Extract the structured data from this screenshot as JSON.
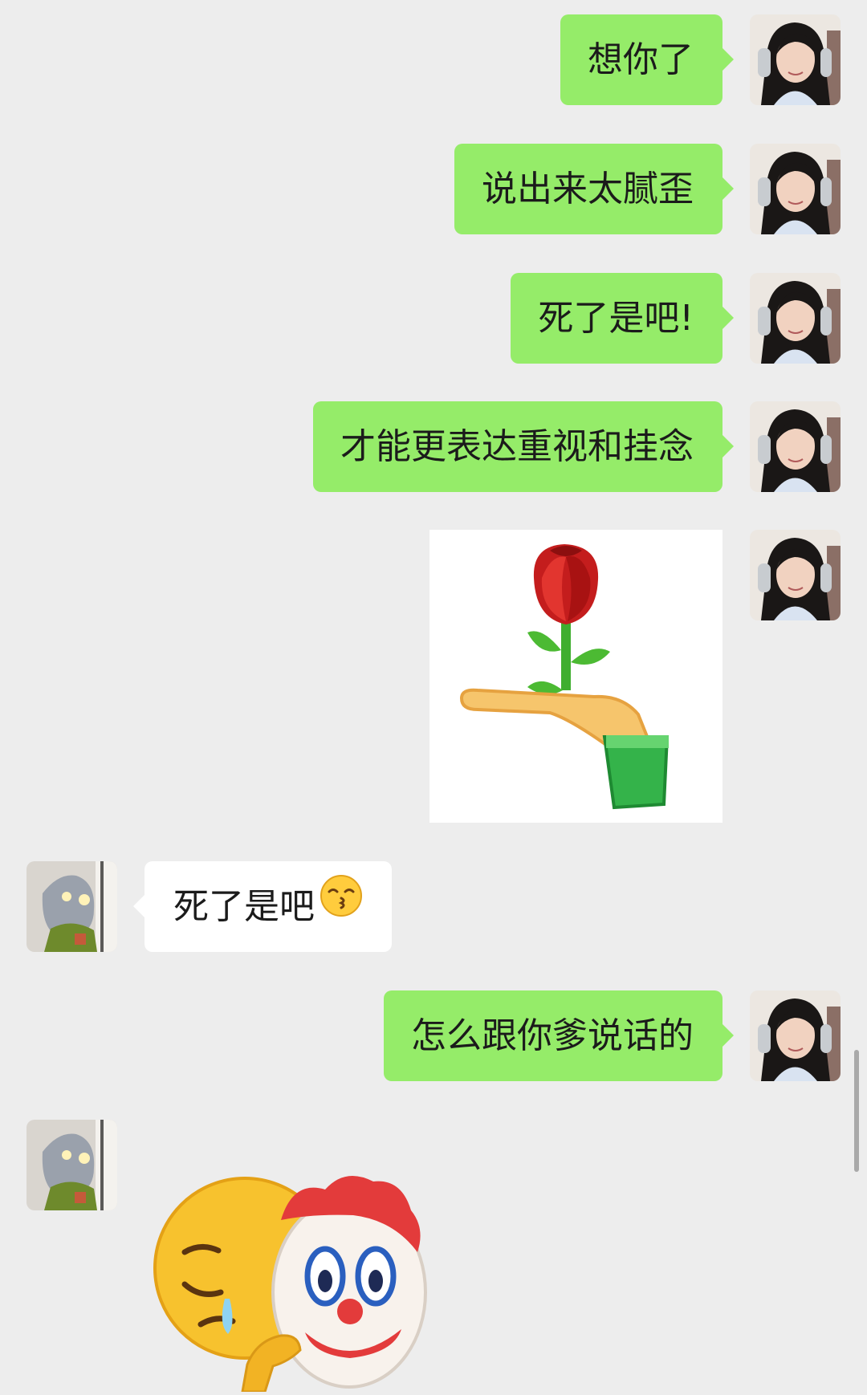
{
  "chat": {
    "messages": [
      {
        "sender": "me",
        "type": "text",
        "text": "想你了"
      },
      {
        "sender": "me",
        "type": "text",
        "text": "说出来太腻歪"
      },
      {
        "sender": "me",
        "type": "text",
        "text": "死了是吧!"
      },
      {
        "sender": "me",
        "type": "text",
        "text": "才能更表达重视和挂念"
      },
      {
        "sender": "me",
        "type": "sticker",
        "sticker": "rose-in-hand-sticker"
      },
      {
        "sender": "friend",
        "type": "text",
        "text": "死了是吧",
        "emoji": "kissing-face-emoji"
      },
      {
        "sender": "me",
        "type": "text",
        "text": "怎么跟你爹说话的"
      },
      {
        "sender": "friend",
        "type": "sticker",
        "sticker": "sad-face-with-clown-mask-sticker"
      }
    ]
  },
  "colors": {
    "background": "#ededed",
    "my_bubble": "#95ec69",
    "friend_bubble": "#ffffff",
    "text": "#1b1b1b"
  }
}
